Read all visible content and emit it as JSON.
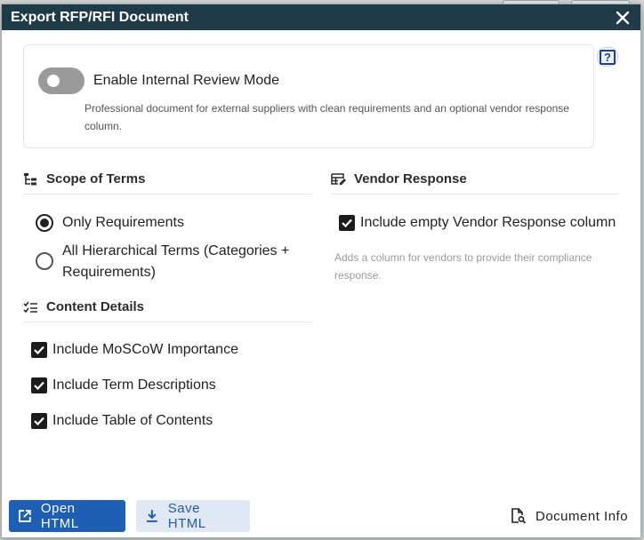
{
  "dialog": {
    "title": "Export RFP/RFI Document"
  },
  "review_mode": {
    "label": "Enable Internal Review Mode",
    "enabled": false,
    "description": "Professional document for external suppliers with clean requirements and an optional vendor response column."
  },
  "scope": {
    "heading": "Scope of Terms",
    "options": [
      {
        "label": "Only Requirements",
        "selected": true
      },
      {
        "label": "All Hierarchical Terms (Categories + Requirements)",
        "selected": false
      }
    ]
  },
  "content": {
    "heading": "Content Details",
    "options": [
      {
        "label": "Include MoSCoW Importance",
        "checked": true
      },
      {
        "label": "Include Term Descriptions",
        "checked": true
      },
      {
        "label": "Include Table of Contents",
        "checked": true
      }
    ]
  },
  "vendor": {
    "heading": "Vendor Response",
    "option": {
      "label": "Include empty Vendor Response column",
      "checked": true
    },
    "note": "Adds a column for vendors to provide their compliance response."
  },
  "footer": {
    "open_label": "Open HTML",
    "save_label": "Save HTML",
    "info_label": "Document Info"
  },
  "colors": {
    "titlebar": "#1f3b48",
    "primary": "#1e5fb4",
    "secondary_bg": "#dfe8f3",
    "help": "#1e3f91"
  },
  "icons": {
    "close": "close-icon",
    "help": "help-icon",
    "scope": "hierarchy-icon",
    "content": "checklist-icon",
    "vendor": "table-edit-icon",
    "open": "open-external-icon",
    "save": "download-icon",
    "info": "document-search-icon"
  }
}
